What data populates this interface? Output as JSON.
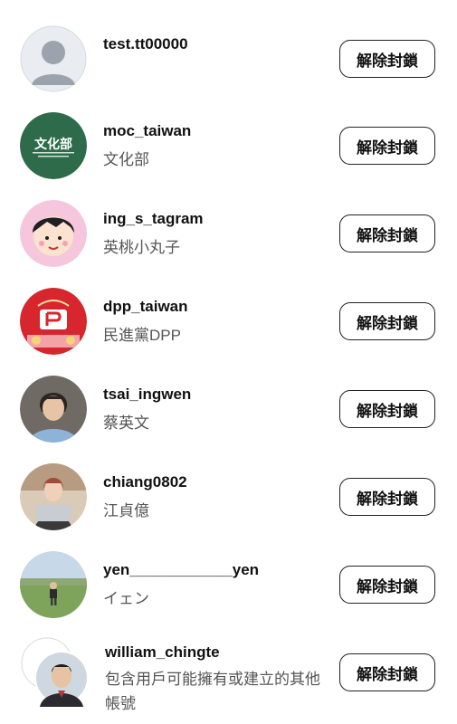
{
  "blocked_list": {
    "unblock_label": "解除封鎖",
    "accounts": [
      {
        "username": "test.tt00000",
        "full_name": "",
        "avatar_icon": "default-user-avatar-icon"
      },
      {
        "username": "moc_taiwan",
        "full_name": "文化部",
        "avatar_icon": "ministry-of-culture-logo"
      },
      {
        "username": "ing_s_tagram",
        "full_name": "英桃小丸子",
        "avatar_icon": "cartoon-girl-avatar"
      },
      {
        "username": "dpp_taiwan",
        "full_name": "民進黨DPP",
        "avatar_icon": "dpp-new-year-avatar"
      },
      {
        "username": "tsai_ingwen",
        "full_name": "蔡英文",
        "avatar_icon": "person-photo-avatar"
      },
      {
        "username": "chiang0802",
        "full_name": "江貞億",
        "avatar_icon": "person-laptop-photo-avatar"
      },
      {
        "username": "yen____________yen",
        "full_name": "イェン",
        "avatar_icon": "child-outdoor-photo-avatar"
      },
      {
        "username": "william_chingte",
        "full_name": "包含用戶可能擁有或建立的其他帳號",
        "avatar_icon": "multi-account-avatar"
      }
    ]
  },
  "colors": {
    "moc_green": "#2e6b4a",
    "dpp_red": "#d7262e",
    "default_avatar_bg": "#e6e9ee",
    "default_avatar_fg": "#9aa3ad"
  }
}
